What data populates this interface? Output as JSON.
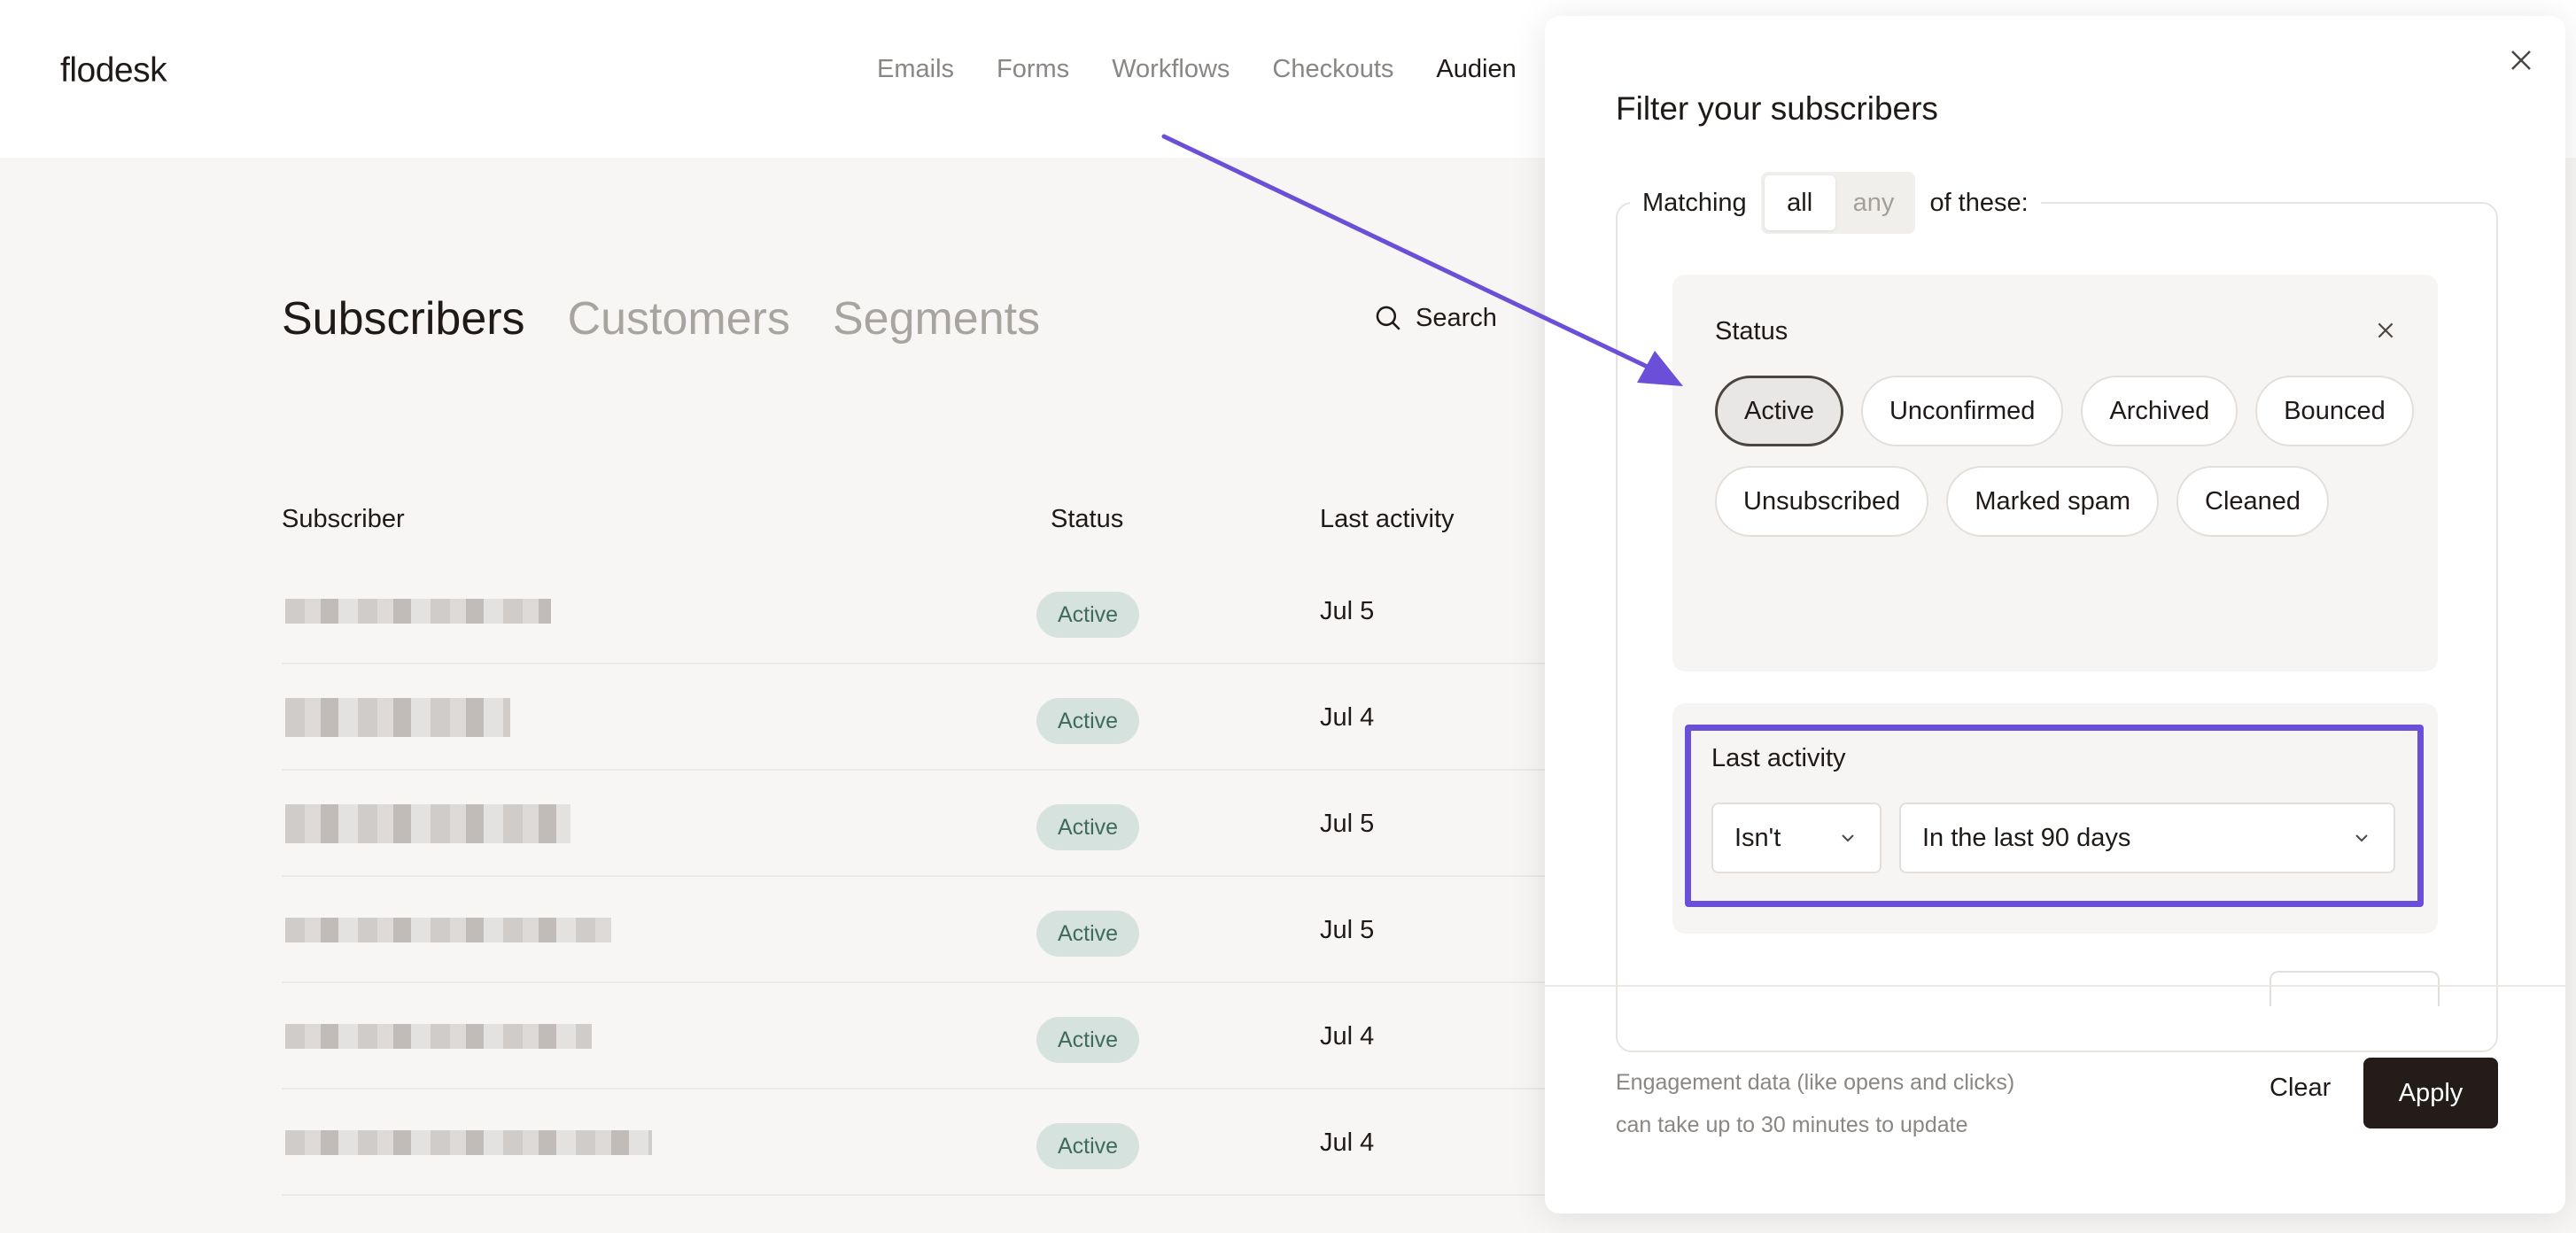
{
  "app": {
    "logo": "flodesk",
    "nav": [
      "Emails",
      "Forms",
      "Workflows",
      "Checkouts",
      "Audien"
    ]
  },
  "main": {
    "tabs": [
      "Subscribers",
      "Customers",
      "Segments"
    ],
    "search_label": "Search",
    "columns": {
      "subscriber": "Subscriber",
      "status": "Status",
      "last_activity": "Last activity"
    },
    "rows": [
      {
        "status": "Active",
        "last_activity": "Jul 5"
      },
      {
        "status": "Active",
        "last_activity": "Jul 4"
      },
      {
        "status": "Active",
        "last_activity": "Jul 5"
      },
      {
        "status": "Active",
        "last_activity": "Jul 5"
      },
      {
        "status": "Active",
        "last_activity": "Jul 4"
      },
      {
        "status": "Active",
        "last_activity": "Jul 4"
      }
    ]
  },
  "panel": {
    "title": "Filter your subscribers",
    "matching_label": "Matching",
    "match_options": [
      "all",
      "any"
    ],
    "match_selected": "all",
    "of_these_label": "of these:",
    "status_card": {
      "title": "Status",
      "chips": [
        "Active",
        "Unconfirmed",
        "Archived",
        "Bounced",
        "Unsubscribed",
        "Marked spam",
        "Cleaned"
      ],
      "selected": "Active"
    },
    "activity_card": {
      "title": "Last activity",
      "operator": "Isn't",
      "range": "In the last 90 days"
    },
    "footer_note_line1": "Engagement data (like opens and clicks)",
    "footer_note_line2": "can take up to 30 minutes to update",
    "clear_label": "Clear",
    "apply_label": "Apply"
  },
  "colors": {
    "annotation": "#6b4fd8",
    "apply_bg": "#231c19",
    "badge_bg": "#d5e2dd",
    "badge_text": "#3f6b5c"
  }
}
